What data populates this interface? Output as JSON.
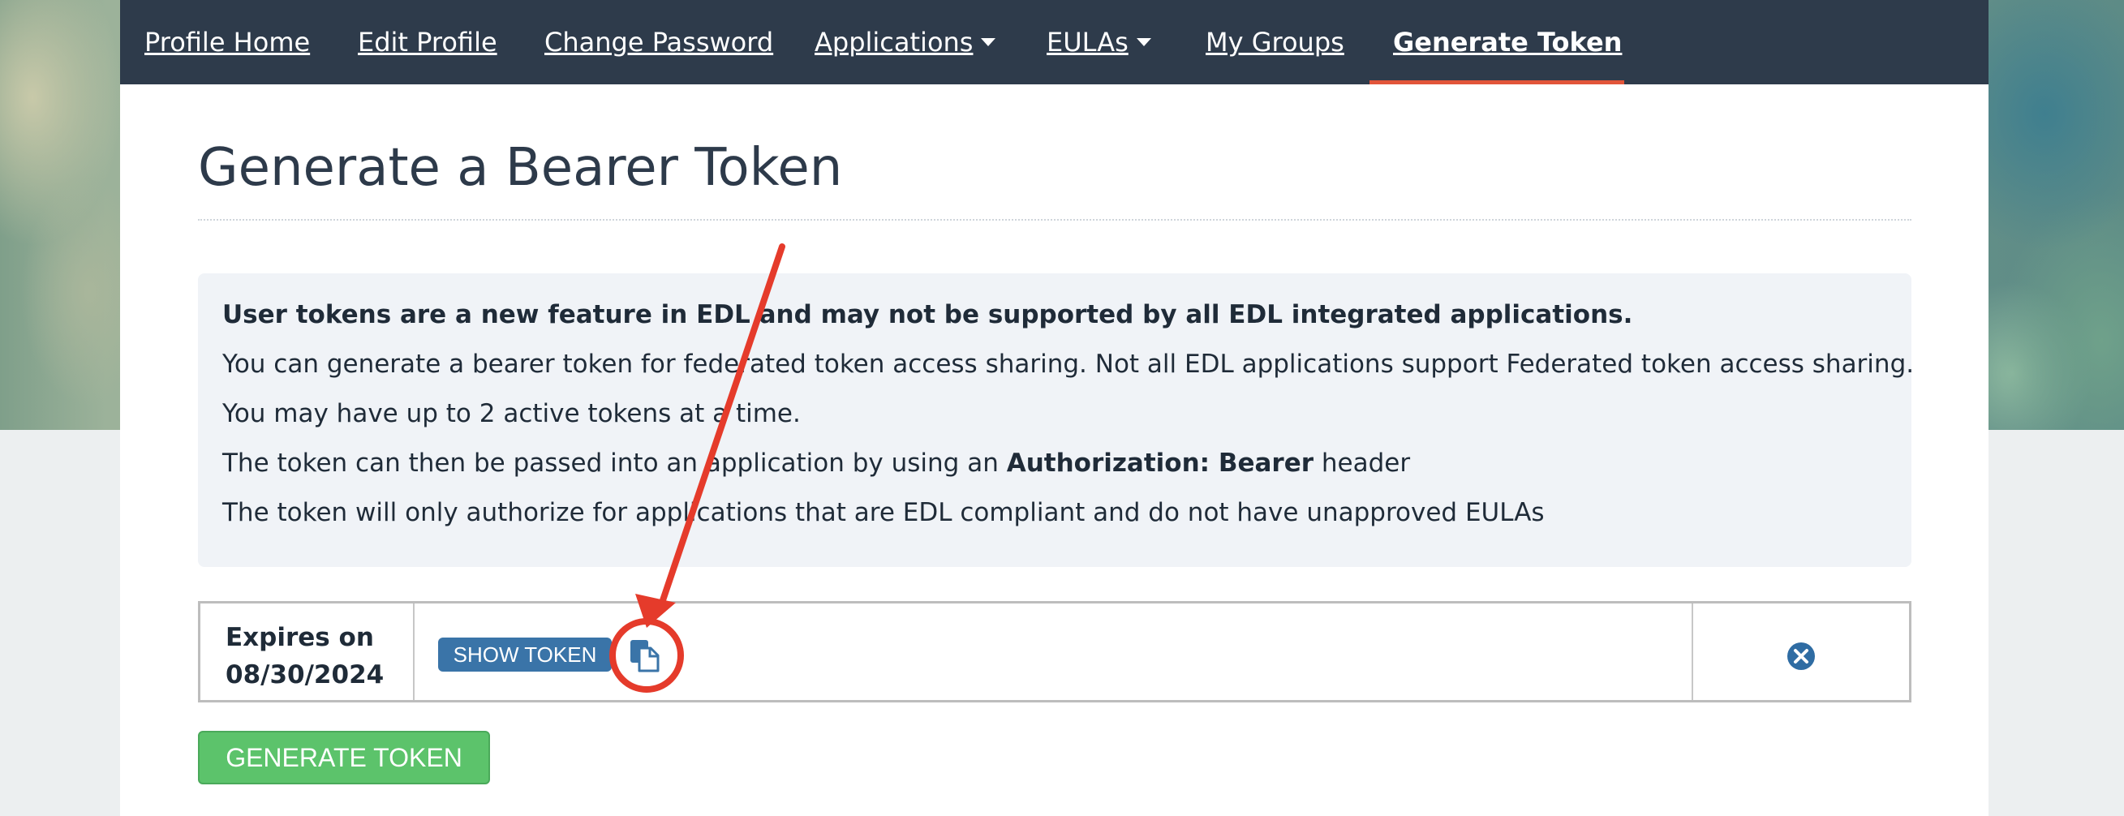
{
  "nav": {
    "items": [
      {
        "label": "Profile Home"
      },
      {
        "label": "Edit Profile"
      },
      {
        "label": "Change Password"
      },
      {
        "label": "Applications"
      },
      {
        "label": "EULAs"
      },
      {
        "label": "My Groups"
      },
      {
        "label": "Generate Token"
      }
    ],
    "active_index": 6,
    "active_color": "#e2553a"
  },
  "page": {
    "title": "Generate a Bearer Token"
  },
  "info": {
    "heading": "User tokens are a new feature in EDL and may not be supported by all EDL integrated applications.",
    "line1": "You can generate a bearer token for federated token access sharing. Not all EDL applications support Federated token access sharing.",
    "line2": "You may have up to 2 active tokens at a time.",
    "line3_prefix": "The token can then be passed into an application by using an",
    "line3_bold": "Authorization: Bearer",
    "line3_suffix": "header",
    "line4": "The token will only authorize for applications that are EDL compliant and do not have unapproved EULAs"
  },
  "token": {
    "expires_label": "Expires on",
    "expires_date": "08/30/2024",
    "show_label": "SHOW TOKEN",
    "copy_icon": "copy-icon",
    "remove_icon": "remove-circle-icon"
  },
  "actions": {
    "generate_label": "GENERATE TOKEN"
  },
  "colors": {
    "nav_bg": "#2e3b4b",
    "primary_button": "#3a74a8",
    "success_button": "#5cc36b",
    "annotation": "#e53b2b"
  }
}
